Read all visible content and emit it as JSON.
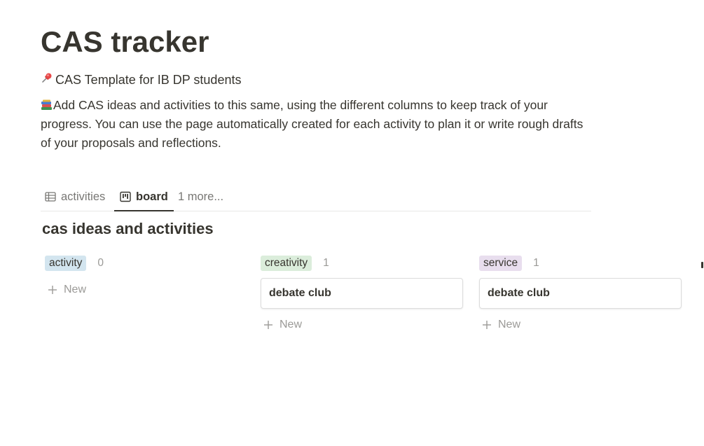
{
  "page": {
    "title": "CAS tracker",
    "subtitle_icon": "pushpin-icon",
    "subtitle": "CAS Template for IB DP students",
    "description_icon": "books-icon",
    "description": "Add CAS ideas and activities to this same, using the different columns to keep track of your progress. You can use the page automatically created for each activity to plan it or write rough drafts of your proposals and reflections."
  },
  "tabs": [
    {
      "label": "activities",
      "icon": "table-icon",
      "active": false
    },
    {
      "label": "board",
      "icon": "board-icon",
      "active": true
    },
    {
      "label": "1 more...",
      "icon": "",
      "active": false
    }
  ],
  "board": {
    "title": "cas ideas and activities",
    "columns": [
      {
        "label": "activity",
        "count": "0",
        "color": "#d3e5ef",
        "cards": []
      },
      {
        "label": "creativity",
        "count": "1",
        "color": "#dbeddb",
        "cards": [
          {
            "title": "debate club"
          }
        ]
      },
      {
        "label": "service",
        "count": "1",
        "color": "#e8deee",
        "cards": [
          {
            "title": "debate club"
          }
        ]
      }
    ],
    "new_label": "New"
  }
}
